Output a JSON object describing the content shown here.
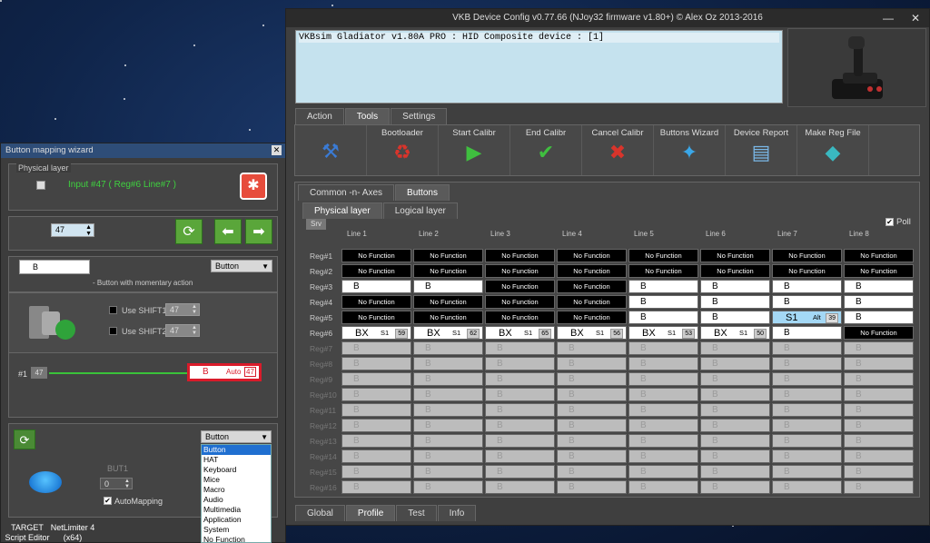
{
  "main_window": {
    "title": "VKB Device Config v0.77.66 (NJoy32 firmware v1.80+) © Alex Oz 2013-2016",
    "device_entry": "VKBsim Gladiator  v1.80A PRO                 : HID Composite device : [1]",
    "top_tabs": [
      "Action",
      "Tools",
      "Settings"
    ],
    "active_top_tab": "Tools",
    "tools": [
      {
        "label": "",
        "icon": "tools-icon"
      },
      {
        "label": "Bootloader",
        "icon": "recycle-icon"
      },
      {
        "label": "Start Calibr",
        "icon": "caliper-play-icon"
      },
      {
        "label": "End Calibr",
        "icon": "caliper-check-icon"
      },
      {
        "label": "Cancel Calibr",
        "icon": "caliper-cancel-icon"
      },
      {
        "label": "Buttons Wizard",
        "icon": "wizard-icon"
      },
      {
        "label": "Device Report",
        "icon": "report-icon"
      },
      {
        "label": "Make Reg File",
        "icon": "cube-icon"
      }
    ],
    "sub_tabs": [
      "Common -n- Axes",
      "Buttons"
    ],
    "active_sub_tab": "Buttons",
    "layer_tabs": [
      "Physical layer",
      "Logical layer"
    ],
    "active_layer_tab": "Physical layer",
    "srv_label": "Srv",
    "poll_label": "Poll",
    "poll_checked": true,
    "line_headers": [
      "Line 1",
      "Line 2",
      "Line 3",
      "Line 4",
      "Line 5",
      "Line 6",
      "Line 7",
      "Line 8"
    ],
    "rows": [
      {
        "label": "Reg#1",
        "cells": [
          {
            "t": "nf",
            "v": "No Function"
          },
          {
            "t": "nf",
            "v": "No Function"
          },
          {
            "t": "nf",
            "v": "No Function"
          },
          {
            "t": "nf",
            "v": "No Function"
          },
          {
            "t": "nf",
            "v": "No Function"
          },
          {
            "t": "nf",
            "v": "No Function"
          },
          {
            "t": "nf",
            "v": "No Function"
          },
          {
            "t": "nf",
            "v": "No Function"
          }
        ]
      },
      {
        "label": "Reg#2",
        "cells": [
          {
            "t": "nf",
            "v": "No Function"
          },
          {
            "t": "nf",
            "v": "No Function"
          },
          {
            "t": "nf",
            "v": "No Function"
          },
          {
            "t": "nf",
            "v": "No Function"
          },
          {
            "t": "nf",
            "v": "No Function"
          },
          {
            "t": "nf",
            "v": "No Function"
          },
          {
            "t": "nf",
            "v": "No Function"
          },
          {
            "t": "nf",
            "v": "No Function"
          }
        ]
      },
      {
        "label": "Reg#3",
        "cells": [
          {
            "t": "b",
            "v": "B"
          },
          {
            "t": "b",
            "v": "B"
          },
          {
            "t": "nf",
            "v": "No Function"
          },
          {
            "t": "nf",
            "v": "No Function"
          },
          {
            "t": "b",
            "v": "B"
          },
          {
            "t": "b",
            "v": "B"
          },
          {
            "t": "b",
            "v": "B"
          },
          {
            "t": "b",
            "v": "B"
          }
        ]
      },
      {
        "label": "Reg#4",
        "cells": [
          {
            "t": "nf",
            "v": "No Function"
          },
          {
            "t": "nf",
            "v": "No Function"
          },
          {
            "t": "nf",
            "v": "No Function"
          },
          {
            "t": "nf",
            "v": "No Function"
          },
          {
            "t": "b",
            "v": "B"
          },
          {
            "t": "b",
            "v": "B"
          },
          {
            "t": "b",
            "v": "B"
          },
          {
            "t": "b",
            "v": "B"
          }
        ]
      },
      {
        "label": "Reg#5",
        "cells": [
          {
            "t": "nf",
            "v": "No Function"
          },
          {
            "t": "nf",
            "v": "No Function"
          },
          {
            "t": "nf",
            "v": "No Function"
          },
          {
            "t": "nf",
            "v": "No Function"
          },
          {
            "t": "b",
            "v": "B"
          },
          {
            "t": "b",
            "v": "B"
          },
          {
            "t": "s1",
            "v": "S1",
            "a": "Alt",
            "n": "39"
          },
          {
            "t": "b",
            "v": "B"
          }
        ]
      },
      {
        "label": "Reg#6",
        "cells": [
          {
            "t": "bx",
            "v": "BX",
            "s": "S1",
            "n": "59"
          },
          {
            "t": "bx",
            "v": "BX",
            "s": "S1",
            "n": "62"
          },
          {
            "t": "bx",
            "v": "BX",
            "s": "S1",
            "n": "65"
          },
          {
            "t": "bx",
            "v": "BX",
            "s": "S1",
            "n": "56"
          },
          {
            "t": "bx",
            "v": "BX",
            "s": "S1",
            "n": "53"
          },
          {
            "t": "bx",
            "v": "BX",
            "s": "S1",
            "n": "50"
          },
          {
            "t": "b",
            "v": "B"
          },
          {
            "t": "nf",
            "v": "No Function"
          }
        ]
      },
      {
        "label": "Reg#7",
        "dim": true
      },
      {
        "label": "Reg#8",
        "dim": true
      },
      {
        "label": "Reg#9",
        "dim": true
      },
      {
        "label": "Reg#10",
        "dim": true
      },
      {
        "label": "Reg#11",
        "dim": true
      },
      {
        "label": "Reg#12",
        "dim": true
      },
      {
        "label": "Reg#13",
        "dim": true
      },
      {
        "label": "Reg#14",
        "dim": true
      },
      {
        "label": "Reg#15",
        "dim": true
      },
      {
        "label": "Reg#16",
        "dim": true
      }
    ],
    "disabled_cell_value": "B",
    "bottom_tabs": [
      "Global",
      "Profile",
      "Test",
      "Info"
    ],
    "active_bottom_tab": "Profile"
  },
  "wizard": {
    "title": "Button mapping wizard",
    "physical_layer_label": "Physical layer",
    "input_info": "Input #47  ( Reg#6  Line#7 )",
    "button_number": "47",
    "mapping_value": "B",
    "type_select": "Button",
    "momentary_desc": "- Button with momentary action",
    "shift1_label": "Use SHIFT1",
    "shift1_value": "47",
    "shift2_label": "Use SHIFT2",
    "shift2_value": "47",
    "chain_index": "#1",
    "chain_input": "47",
    "chain_result_value": "B",
    "chain_result_mode": "Auto",
    "chain_result_num": "47",
    "but_label": "BUT1",
    "but_value": "0",
    "automapping_label": "AutoMapping",
    "automapping_checked": true,
    "dropdown_value": "Button",
    "dropdown_options": [
      "Button",
      "HAT",
      "Keyboard",
      "Mice",
      "Macro",
      "Audio",
      "Multimedia",
      "Application",
      "System",
      "No Function"
    ],
    "dropdown_selected_index": 0
  },
  "desktop": {
    "items": [
      {
        "label": "TARGET Script Editor"
      },
      {
        "label": "NetLimiter 4 (x64)"
      }
    ]
  },
  "colors": {
    "accent_green": "#5aa63a",
    "cell_highlight": "#a4d8f5",
    "selection_blue": "#1f6fd0"
  }
}
